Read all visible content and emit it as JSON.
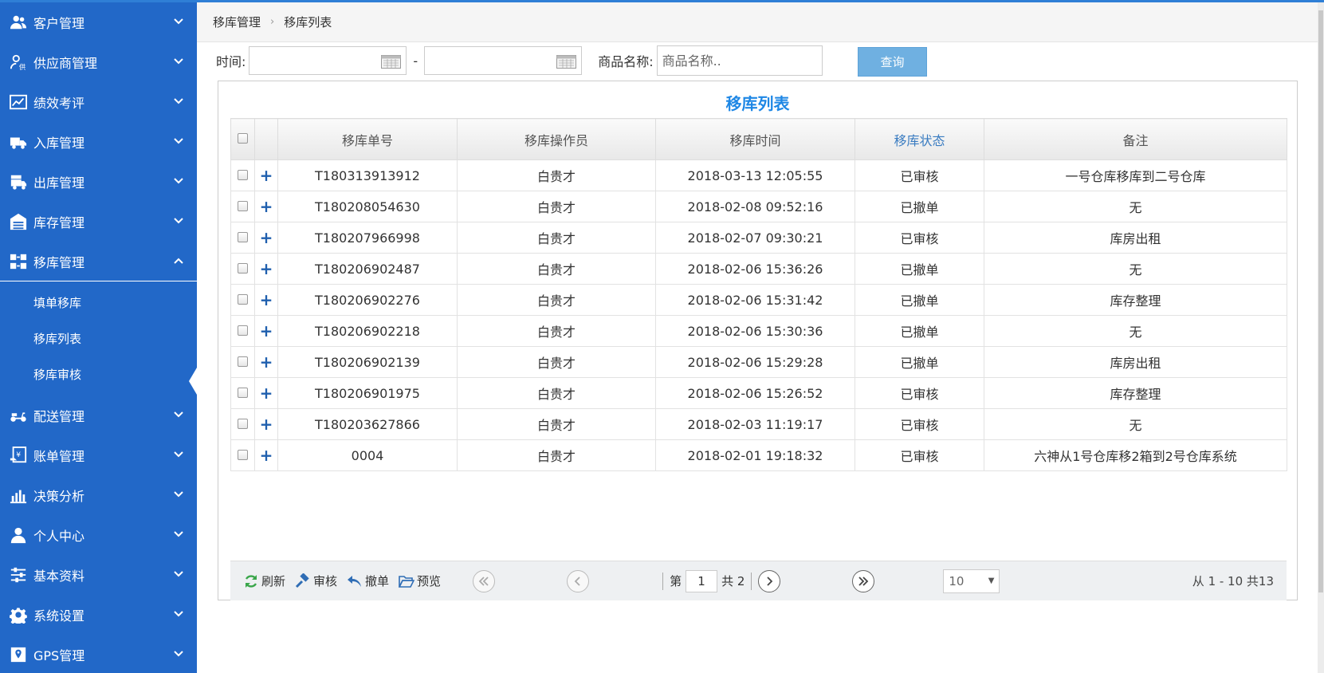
{
  "sidebar": {
    "items": [
      {
        "label": "客户管理",
        "icon": "customers-icon"
      },
      {
        "label": "供应商管理",
        "icon": "supplier-icon"
      },
      {
        "label": "绩效考评",
        "icon": "chart-line-icon"
      },
      {
        "label": "入库管理",
        "icon": "truck-in-icon"
      },
      {
        "label": "出库管理",
        "icon": "truck-out-icon"
      },
      {
        "label": "库存管理",
        "icon": "warehouse-icon"
      },
      {
        "label": "移库管理",
        "icon": "transfer-icon"
      },
      {
        "label": "配送管理",
        "icon": "scooter-icon"
      },
      {
        "label": "账单管理",
        "icon": "bill-icon"
      },
      {
        "label": "决策分析",
        "icon": "bar-chart-icon"
      },
      {
        "label": "个人中心",
        "icon": "user-icon"
      },
      {
        "label": "基本资料",
        "icon": "sliders-icon"
      },
      {
        "label": "系统设置",
        "icon": "gear-icon"
      },
      {
        "label": "GPS管理",
        "icon": "map-pin-icon"
      }
    ],
    "sub_items": [
      {
        "label": "填单移库"
      },
      {
        "label": "移库列表"
      },
      {
        "label": "移库审核"
      }
    ]
  },
  "breadcrumb": {
    "parent": "移库管理",
    "current": "移库列表",
    "separator": "›"
  },
  "filter": {
    "time_label": "时间:",
    "dash": "-",
    "name_label": "商品名称:",
    "name_placeholder": "商品名称..",
    "query_label": "查询"
  },
  "panel": {
    "title": "移库列表"
  },
  "table": {
    "headers": [
      "移库单号",
      "移库操作员",
      "移库时间",
      "移库状态",
      "备注"
    ],
    "rows": [
      {
        "id": "T180313913912",
        "operator": "白贵才",
        "time": "2018-03-13 12:05:55",
        "status": "已审核",
        "note": "一号仓库移库到二号仓库"
      },
      {
        "id": "T180208054630",
        "operator": "白贵才",
        "time": "2018-02-08 09:52:16",
        "status": "已撤单",
        "note": "无"
      },
      {
        "id": "T180207966998",
        "operator": "白贵才",
        "time": "2018-02-07 09:30:21",
        "status": "已审核",
        "note": "库房出租"
      },
      {
        "id": "T180206902487",
        "operator": "白贵才",
        "time": "2018-02-06 15:36:26",
        "status": "已撤单",
        "note": "无"
      },
      {
        "id": "T180206902276",
        "operator": "白贵才",
        "time": "2018-02-06 15:31:42",
        "status": "已撤单",
        "note": "库存整理"
      },
      {
        "id": "T180206902218",
        "operator": "白贵才",
        "time": "2018-02-06 15:30:36",
        "status": "已撤单",
        "note": "无"
      },
      {
        "id": "T180206902139",
        "operator": "白贵才",
        "time": "2018-02-06 15:29:28",
        "status": "已撤单",
        "note": "库房出租"
      },
      {
        "id": "T180206901975",
        "operator": "白贵才",
        "time": "2018-02-06 15:26:52",
        "status": "已审核",
        "note": "库存整理"
      },
      {
        "id": "T180203627866",
        "operator": "白贵才",
        "time": "2018-02-03 11:19:17",
        "status": "已审核",
        "note": "无"
      },
      {
        "id": "0004",
        "operator": "白贵才",
        "time": "2018-02-01 19:18:32",
        "status": "已审核",
        "note": "六神从1号仓库移2箱到2号仓库系统"
      }
    ]
  },
  "pager": {
    "refresh": "刷新",
    "approve": "审核",
    "revoke": "撤单",
    "preview": "预览",
    "page_prefix": "第",
    "page": "1",
    "total_pages": "共 2",
    "page_size": "10",
    "summary": "从 1 - 10 共13"
  },
  "colors": {
    "sidebar": "#2268c8",
    "accent": "#1e87e5",
    "query_button": "#6fb0e1"
  }
}
